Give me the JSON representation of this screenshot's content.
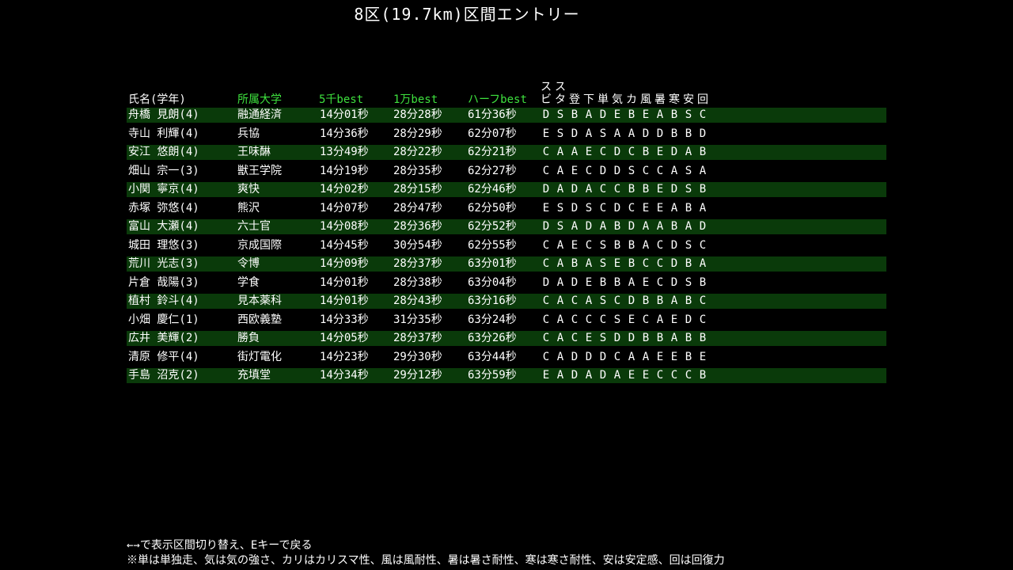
{
  "title": "8区(19.7km)区間エントリー",
  "header": {
    "name": "氏名(学年)",
    "university": "所属大学",
    "best5k": "5千best",
    "best10k": "1万best",
    "half": "ハーフbest",
    "abilities": [
      {
        "top": "ス",
        "bottom": "ビ"
      },
      {
        "top": "ス",
        "bottom": "タ"
      },
      {
        "top": "",
        "bottom": "登"
      },
      {
        "top": "",
        "bottom": "下"
      },
      {
        "top": "",
        "bottom": "単"
      },
      {
        "top": "",
        "bottom": "気"
      },
      {
        "top": "",
        "bottom": "カ"
      },
      {
        "top": "",
        "bottom": "風"
      },
      {
        "top": "",
        "bottom": "暑"
      },
      {
        "top": "",
        "bottom": "寒"
      },
      {
        "top": "",
        "bottom": "安"
      },
      {
        "top": "",
        "bottom": "回"
      }
    ]
  },
  "runners": [
    {
      "name": "舟橋 見朗(4)",
      "university": "融通経済",
      "best5k": "14分01秒",
      "best10k": "28分28秒",
      "half": "61分36秒",
      "grades": [
        "D",
        "S",
        "B",
        "A",
        "D",
        "E",
        "B",
        "E",
        "A",
        "B",
        "S",
        "C"
      ]
    },
    {
      "name": "寺山 利輝(4)",
      "university": "兵協",
      "best5k": "14分36秒",
      "best10k": "28分29秒",
      "half": "62分07秒",
      "grades": [
        "E",
        "S",
        "D",
        "A",
        "S",
        "A",
        "A",
        "D",
        "D",
        "B",
        "B",
        "D"
      ]
    },
    {
      "name": "安江 悠朗(4)",
      "university": "王味醂",
      "best5k": "13分49秒",
      "best10k": "28分22秒",
      "half": "62分21秒",
      "grades": [
        "C",
        "A",
        "A",
        "E",
        "C",
        "D",
        "C",
        "B",
        "E",
        "D",
        "A",
        "B"
      ]
    },
    {
      "name": "畑山 宗一(3)",
      "university": "獣王学院",
      "best5k": "14分19秒",
      "best10k": "28分35秒",
      "half": "62分27秒",
      "grades": [
        "C",
        "A",
        "E",
        "C",
        "D",
        "D",
        "S",
        "C",
        "C",
        "A",
        "S",
        "A"
      ]
    },
    {
      "name": "小関 寧京(4)",
      "university": "爽快",
      "best5k": "14分02秒",
      "best10k": "28分15秒",
      "half": "62分46秒",
      "grades": [
        "D",
        "A",
        "D",
        "A",
        "C",
        "C",
        "B",
        "B",
        "E",
        "D",
        "S",
        "B"
      ]
    },
    {
      "name": "赤塚 弥悠(4)",
      "university": "熊沢",
      "best5k": "14分07秒",
      "best10k": "28分47秒",
      "half": "62分50秒",
      "grades": [
        "E",
        "S",
        "D",
        "S",
        "C",
        "D",
        "C",
        "E",
        "E",
        "A",
        "B",
        "A"
      ]
    },
    {
      "name": "富山 大瀬(4)",
      "university": "六士官",
      "best5k": "14分08秒",
      "best10k": "28分36秒",
      "half": "62分52秒",
      "grades": [
        "D",
        "S",
        "A",
        "D",
        "A",
        "B",
        "D",
        "A",
        "A",
        "B",
        "A",
        "D"
      ]
    },
    {
      "name": "城田 理悠(3)",
      "university": "京成国際",
      "best5k": "14分45秒",
      "best10k": "30分54秒",
      "half": "62分55秒",
      "grades": [
        "C",
        "A",
        "E",
        "C",
        "S",
        "B",
        "B",
        "A",
        "C",
        "D",
        "S",
        "C"
      ]
    },
    {
      "name": "荒川 光志(3)",
      "university": "令博",
      "best5k": "14分09秒",
      "best10k": "28分37秒",
      "half": "63分01秒",
      "grades": [
        "C",
        "A",
        "B",
        "A",
        "S",
        "E",
        "B",
        "C",
        "C",
        "D",
        "B",
        "A"
      ]
    },
    {
      "name": "片倉 哉陽(3)",
      "university": "学食",
      "best5k": "14分01秒",
      "best10k": "28分38秒",
      "half": "63分04秒",
      "grades": [
        "D",
        "A",
        "D",
        "E",
        "B",
        "B",
        "A",
        "E",
        "C",
        "D",
        "S",
        "B"
      ]
    },
    {
      "name": "植村 鈴斗(4)",
      "university": "見本薬科",
      "best5k": "14分01秒",
      "best10k": "28分43秒",
      "half": "63分16秒",
      "grades": [
        "C",
        "A",
        "C",
        "A",
        "S",
        "C",
        "D",
        "B",
        "B",
        "A",
        "B",
        "C"
      ]
    },
    {
      "name": "小畑 慶仁(1)",
      "university": "西欧義塾",
      "best5k": "14分33秒",
      "best10k": "31分35秒",
      "half": "63分24秒",
      "grades": [
        "C",
        "A",
        "C",
        "C",
        "C",
        "S",
        "E",
        "C",
        "A",
        "E",
        "D",
        "C"
      ]
    },
    {
      "name": "広井 美輝(2)",
      "university": "勝負",
      "best5k": "14分05秒",
      "best10k": "28分37秒",
      "half": "63分26秒",
      "grades": [
        "C",
        "A",
        "C",
        "E",
        "S",
        "D",
        "D",
        "B",
        "B",
        "A",
        "B",
        "B"
      ]
    },
    {
      "name": "清原 修平(4)",
      "university": "街灯電化",
      "best5k": "14分23秒",
      "best10k": "29分30秒",
      "half": "63分44秒",
      "grades": [
        "C",
        "A",
        "D",
        "D",
        "D",
        "C",
        "A",
        "A",
        "E",
        "E",
        "B",
        "E"
      ]
    },
    {
      "name": "手島 沼克(2)",
      "university": "充填堂",
      "best5k": "14分34秒",
      "best10k": "29分12秒",
      "half": "63分59秒",
      "grades": [
        "E",
        "A",
        "D",
        "A",
        "D",
        "A",
        "E",
        "E",
        "C",
        "C",
        "C",
        "B"
      ]
    }
  ],
  "footer": {
    "line1": "←→で表示区間切り替え、Eキーで戻る",
    "line2": "※単は単独走、気は気の強さ、カリはカリスマ性、風は風耐性、暑は暑さ耐性、寒は寒さ耐性、安は安定感、回は回復力"
  },
  "colors": {
    "background": "#000000",
    "row_highlight": "#0a3a0a",
    "header_accent": "#3ee13e",
    "text": "#ffffff"
  }
}
